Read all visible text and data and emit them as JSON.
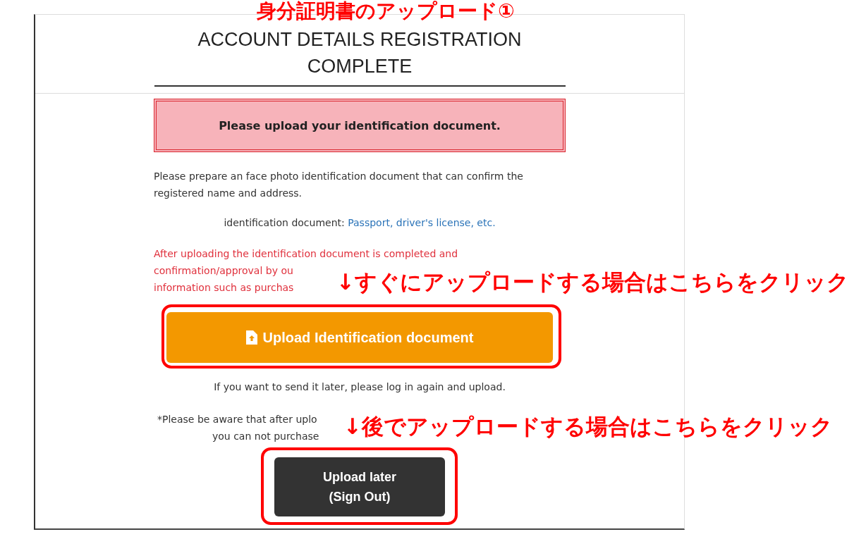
{
  "header": {
    "title_lines": [
      "ACCOUNT DETAILS REGISTRATION",
      "COMPLETE"
    ]
  },
  "alert": {
    "text": "Please upload your identification document."
  },
  "intro": "Please prepare an face photo identification document that can confirm the registered name and address.",
  "id_line": {
    "label": "identification document:",
    "link": "Passport, driver's license, etc."
  },
  "warning_lines": [
    "After uploading the identification document is completed and",
    "confirmation/approval by ou",
    "information such as purchas"
  ],
  "upload_button": {
    "label": "Upload Identification document"
  },
  "later_note": "If you want to send it later, please log in again and upload.",
  "aware_lines": [
    "*Please be aware that after uplo",
    "you can not purchase"
  ],
  "later_button": {
    "lines": [
      "Upload later",
      "(Sign Out)"
    ]
  },
  "annotations": [
    {
      "kind": "title",
      "text": "身分証明書のアップロード①"
    },
    {
      "kind": "callout",
      "text": "↓すぐにアップロードする場合はこちらをクリック"
    },
    {
      "kind": "callout",
      "text": "↓後でアップロードする場合はこちらをクリック"
    }
  ]
}
